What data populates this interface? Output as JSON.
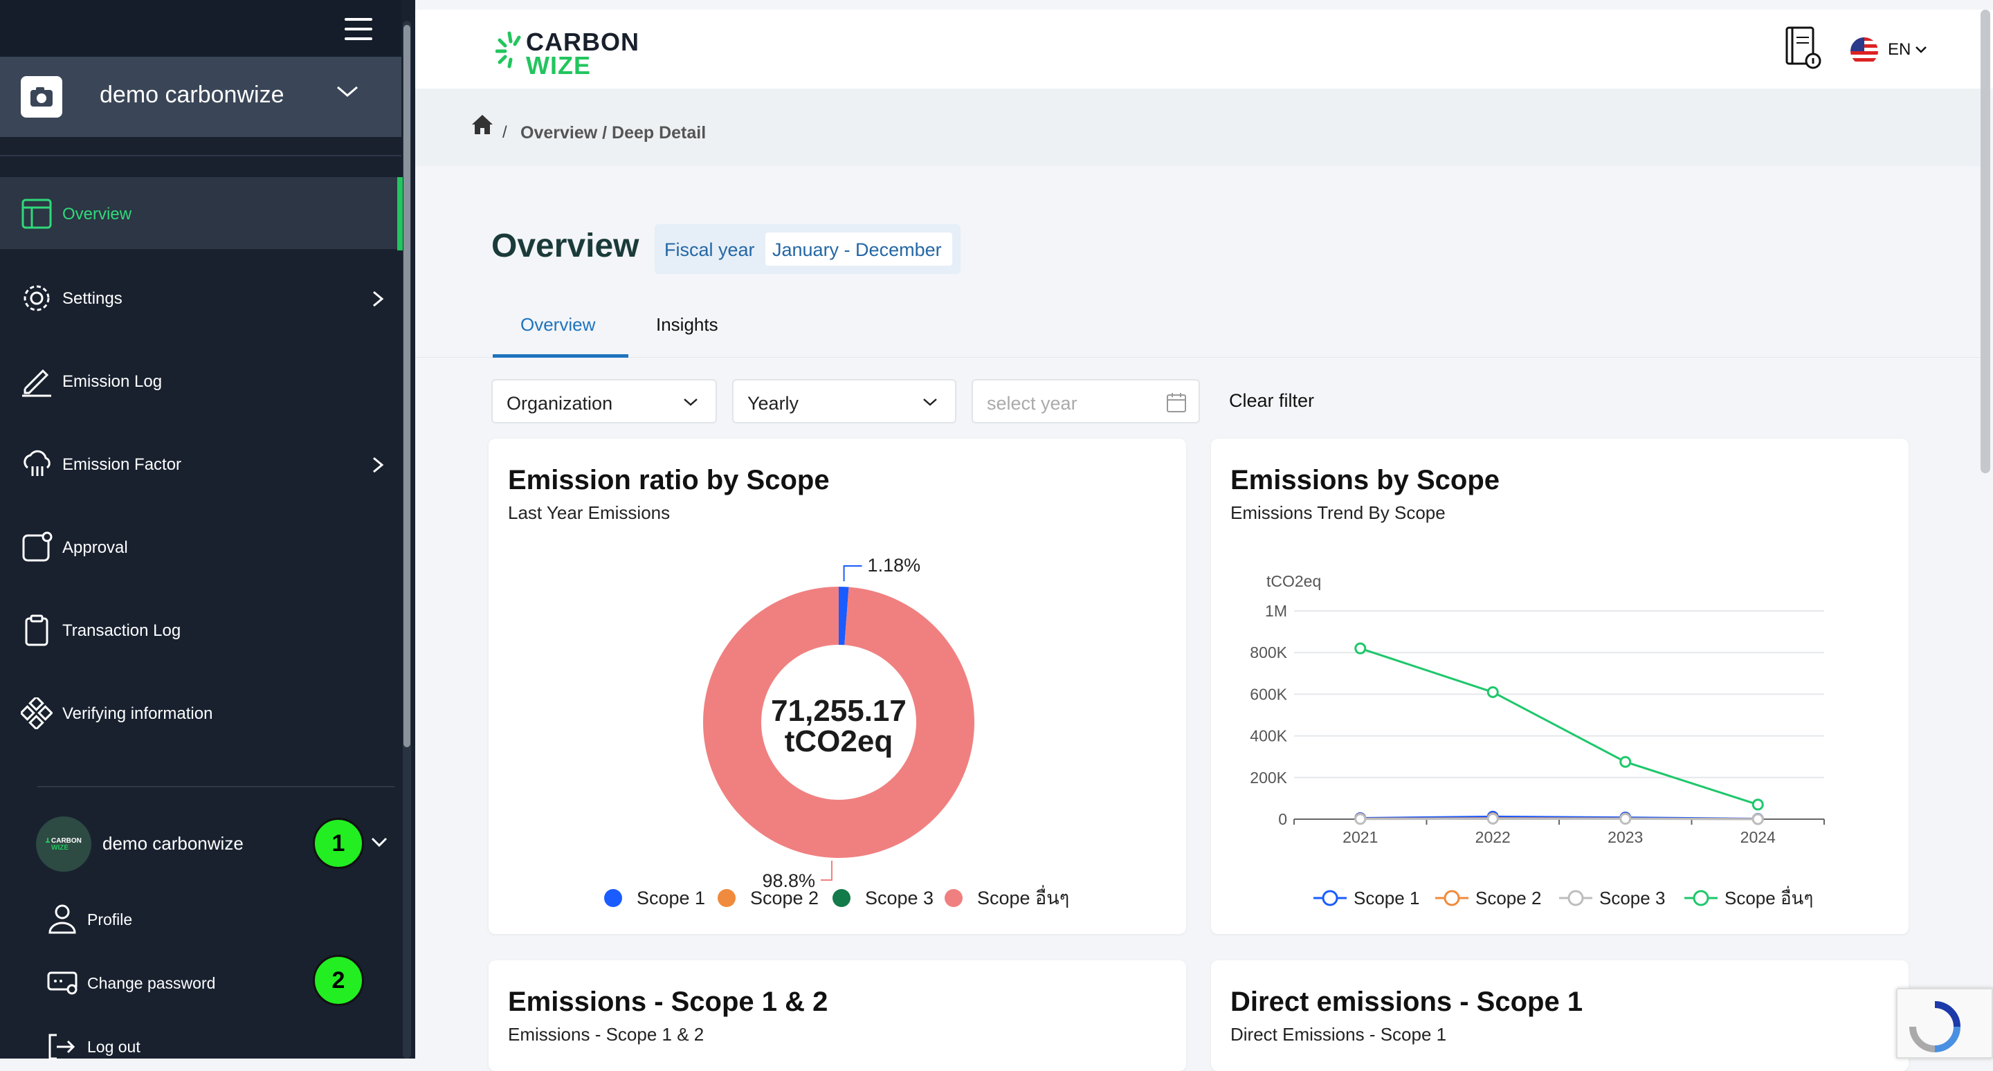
{
  "sidebar": {
    "org_name": "demo carbonwize",
    "items": [
      {
        "label": "Overview"
      },
      {
        "label": "Settings"
      },
      {
        "label": "Emission Log"
      },
      {
        "label": "Emission Factor"
      },
      {
        "label": "Approval"
      },
      {
        "label": "Transaction Log"
      },
      {
        "label": "Verifying information"
      }
    ],
    "user": {
      "name": "demo carbonwize",
      "avatar_text": "CARBON WIZE",
      "badge": "1",
      "menu": [
        {
          "label": "Profile"
        },
        {
          "label": "Change password",
          "badge": "2"
        },
        {
          "label": "Log out"
        }
      ]
    }
  },
  "header": {
    "logo_line1": "CARBON",
    "logo_line2": "WIZE",
    "language": "EN",
    "brand_green": "#22c55e"
  },
  "breadcrumb": {
    "separator": "/",
    "path": "Overview / Deep Detail"
  },
  "page": {
    "title": "Overview",
    "fiscal_label": "Fiscal year",
    "fiscal_range": "January - December"
  },
  "tabs": [
    {
      "label": "Overview",
      "active": true
    },
    {
      "label": "Insights",
      "active": false
    }
  ],
  "filters": {
    "scope_select": "Organization",
    "period_select": "Yearly",
    "year_placeholder": "select year",
    "clear_label": "Clear filter"
  },
  "cards": {
    "ratio": {
      "title": "Emission ratio by Scope",
      "subtitle": "Last Year Emissions"
    },
    "trend": {
      "title": "Emissions by Scope",
      "subtitle": "Emissions Trend By Scope"
    },
    "scope12": {
      "title": "Emissions - Scope 1 & 2",
      "subtitle": "Emissions - Scope 1 & 2"
    },
    "scope1": {
      "title": "Direct emissions - Scope 1",
      "subtitle": "Direct Emissions - Scope 1"
    }
  },
  "chart_data": [
    {
      "type": "pie",
      "center_value": "71,255.17",
      "center_unit": "tCO2eq",
      "categories": [
        "Scope 1",
        "Scope 2",
        "Scope 3",
        "Scope อื่นๆ"
      ],
      "values": [
        1.18,
        0,
        0,
        98.8
      ],
      "labels": [
        "1.18%",
        "",
        "",
        "98.8%"
      ],
      "colors": [
        "#1a5cff",
        "#f08a3c",
        "#137a4a",
        "#f08080"
      ]
    },
    {
      "type": "line",
      "ylabel": "tCO2eq",
      "x": [
        "2021",
        "2022",
        "2023",
        "2024"
      ],
      "ylim": [
        0,
        1000000
      ],
      "yticks": [
        "0",
        "200K",
        "400K",
        "600K",
        "800K",
        "1M"
      ],
      "series": [
        {
          "name": "Scope 1",
          "color": "#1a5cff",
          "values": [
            5000,
            12000,
            8000,
            1500
          ]
        },
        {
          "name": "Scope 2",
          "color": "#f08a3c",
          "values": [
            2000,
            4000,
            3000,
            500
          ]
        },
        {
          "name": "Scope 3",
          "color": "#bdbdbd",
          "values": [
            1000,
            2000,
            1500,
            200
          ]
        },
        {
          "name": "Scope อื่นๆ",
          "color": "#1ec76b",
          "values": [
            820000,
            610000,
            275000,
            70000
          ]
        }
      ]
    }
  ]
}
